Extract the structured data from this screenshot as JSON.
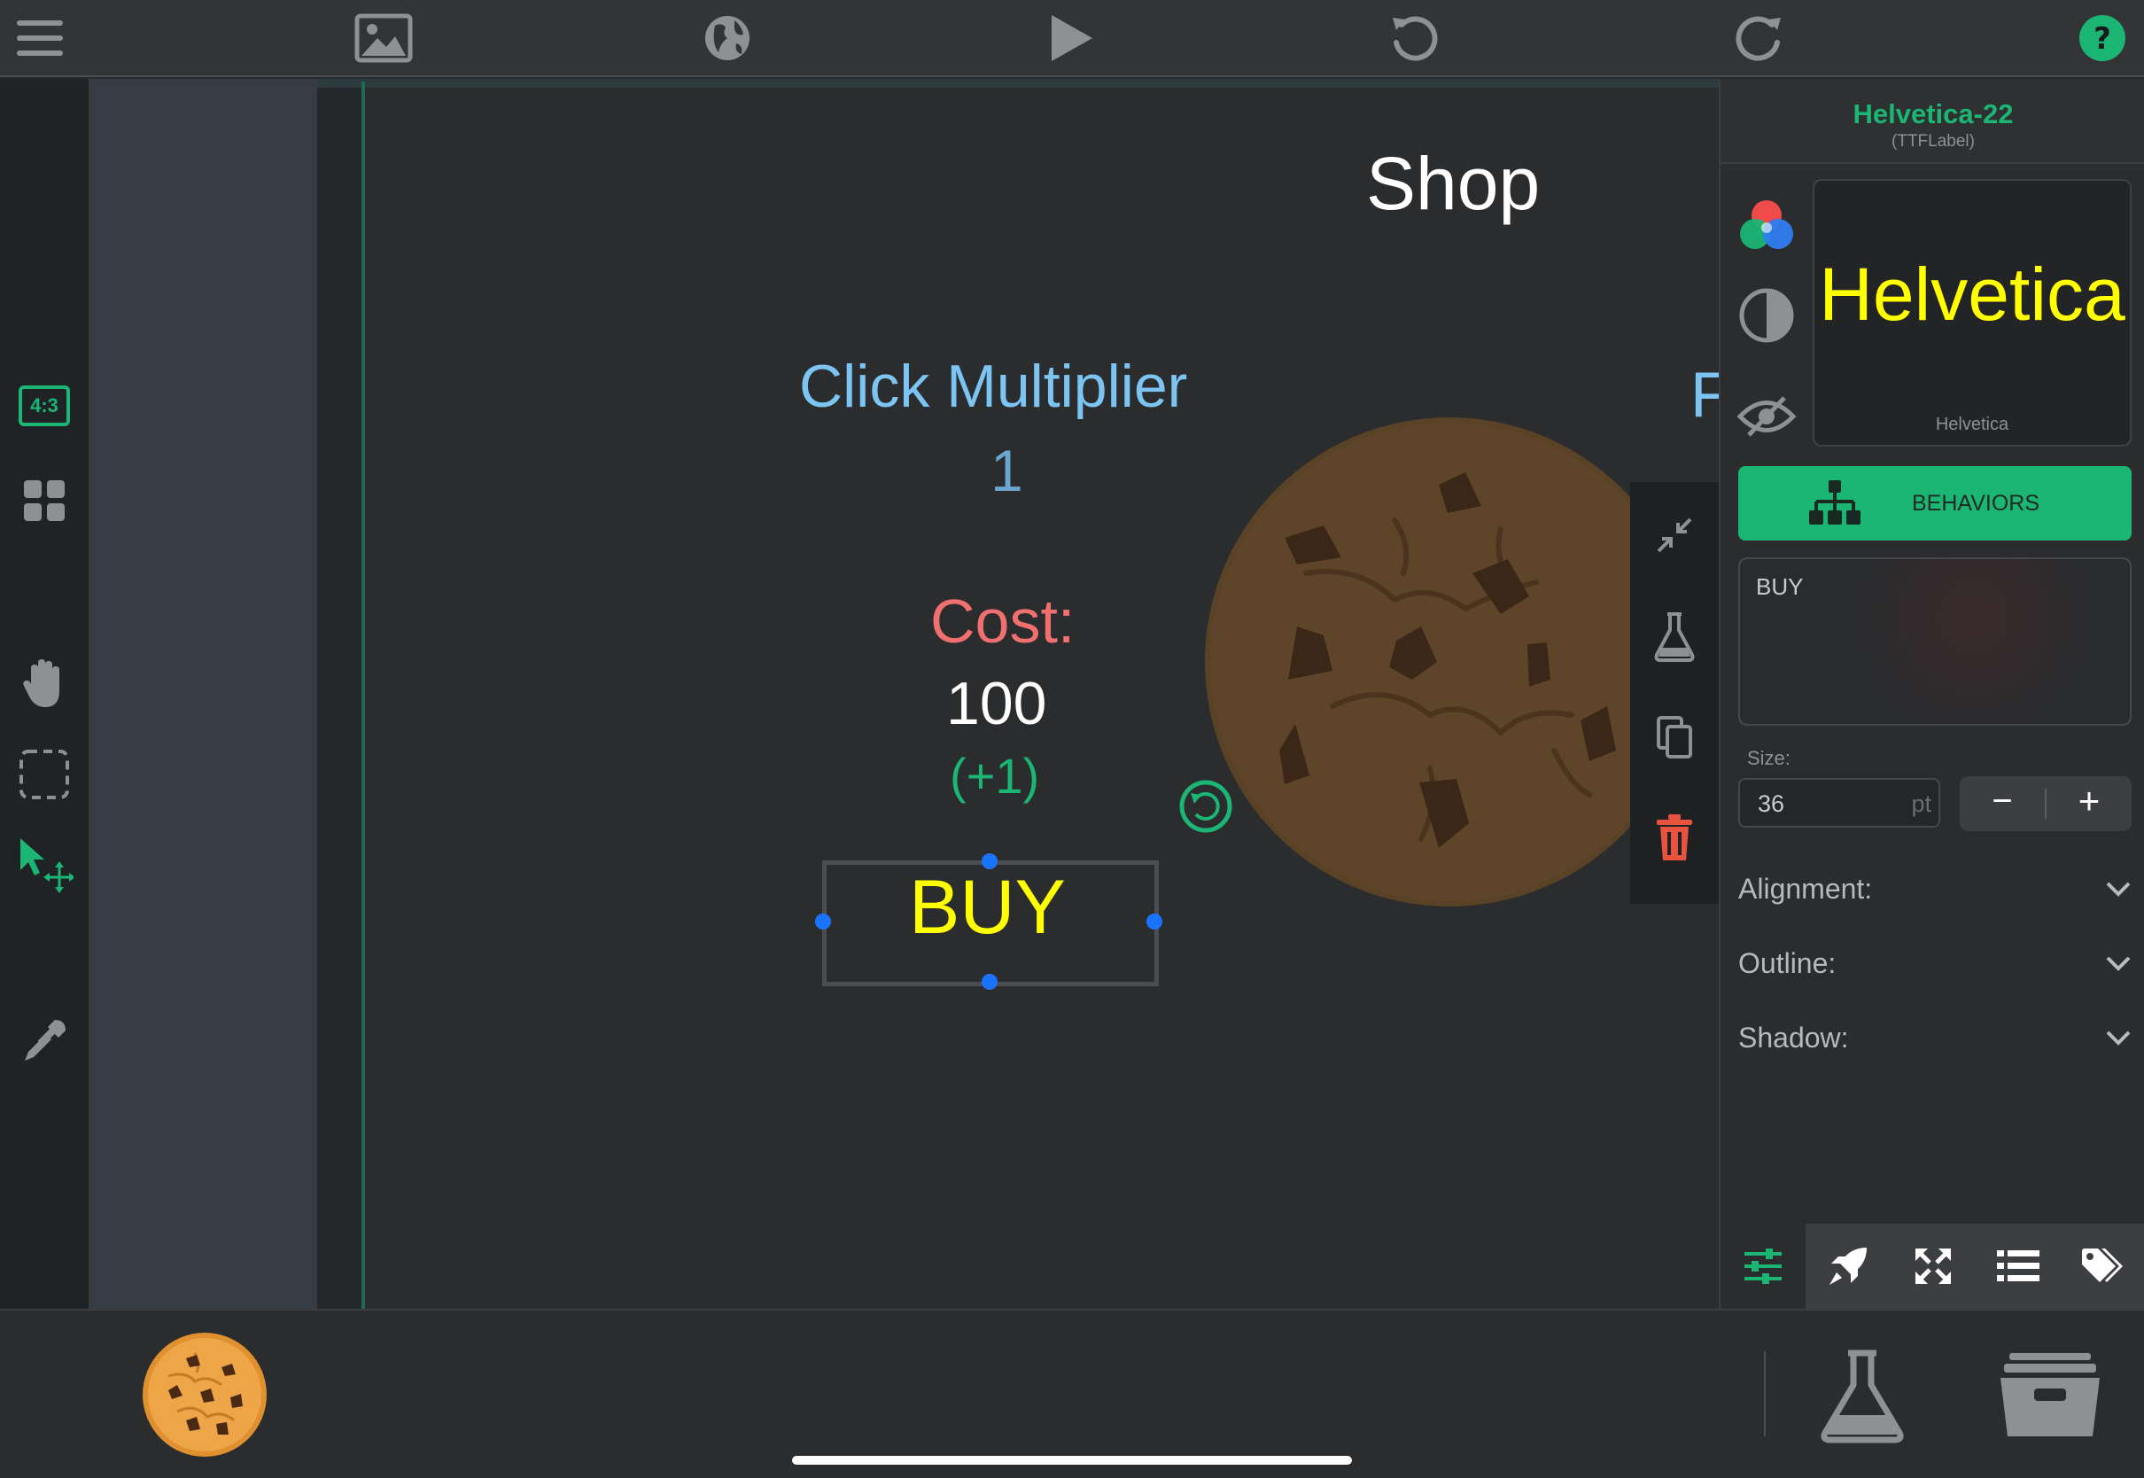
{
  "toolbar": {
    "icons": [
      "menu-icon",
      "image-icon",
      "globe-icon",
      "play-icon",
      "undo-icon",
      "redo-icon",
      "help-icon"
    ]
  },
  "left_toolbar": {
    "aspect_label": "4:3",
    "icons": [
      "aspect-ratio-icon",
      "grid-icon",
      "hand-icon",
      "marquee-select-icon",
      "select-move-icon",
      "eyedropper-icon"
    ]
  },
  "canvas": {
    "title": "Shop",
    "click_multiplier_label": "Click Multiplier",
    "click_multiplier_value": "1",
    "cost_label": "Cost:",
    "cost_value": "100",
    "bonus": "(+1)",
    "buy_label": "BUY",
    "clipped_text": "F",
    "colors": {
      "title": "#ffffff",
      "multiplier": "#7cc4f2",
      "multiplier_value": "#6aa6cf",
      "cost": "#f07070",
      "cost_value": "#ffffff",
      "bonus": "#1bb574",
      "buy": "#ffff00"
    }
  },
  "action_bar": {
    "icons": [
      "shrink-icon",
      "flask-icon",
      "copy-icon",
      "trash-icon"
    ]
  },
  "inspector": {
    "object_name": "Helvetica-22",
    "object_type": "(TTFLabel)",
    "preview_text": "Helvetica",
    "preview_font_name": "Helvetica",
    "behaviors_label": "BEHAVIORS",
    "text_value": "BUY",
    "size_label": "Size:",
    "size_value": "36",
    "size_unit": "pt",
    "minus_label": "−",
    "plus_label": "+",
    "alignment_label": "Alignment:",
    "outline_label": "Outline:",
    "shadow_label": "Shadow:",
    "tabs": [
      "sliders-icon",
      "rocket-icon",
      "expand-icon",
      "list-icon",
      "tags-icon"
    ]
  },
  "bottom_bar": {
    "icons": [
      "cookie-asset-icon",
      "flask-icon",
      "archive-icon"
    ]
  }
}
